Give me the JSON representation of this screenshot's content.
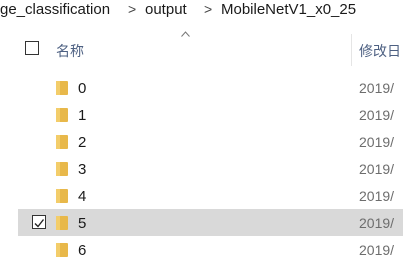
{
  "breadcrumb": {
    "parts": [
      "ge_classification",
      "output",
      "MobileNetV1_x0_25"
    ],
    "separator": ">"
  },
  "columns": {
    "name": "名称",
    "date": "修改日"
  },
  "rows": [
    {
      "name": "0",
      "date": "2019/",
      "selected": false
    },
    {
      "name": "1",
      "date": "2019/",
      "selected": false
    },
    {
      "name": "2",
      "date": "2019/",
      "selected": false
    },
    {
      "name": "3",
      "date": "2019/",
      "selected": false
    },
    {
      "name": "4",
      "date": "2019/",
      "selected": false
    },
    {
      "name": "5",
      "date": "2019/",
      "selected": true
    },
    {
      "name": "6",
      "date": "2019/",
      "selected": false
    }
  ],
  "colors": {
    "folder": "#e8b84a",
    "selected_row": "#d9d9d9",
    "header_text": "#4d6082"
  },
  "icons": {
    "folder": "folder-icon",
    "sort": "sort-up-icon",
    "checkbox": "checkbox-icon"
  }
}
